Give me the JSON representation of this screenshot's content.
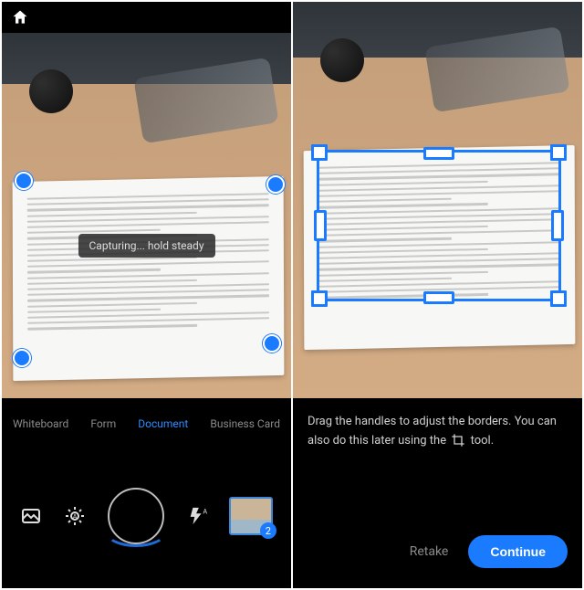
{
  "left": {
    "toast": "Capturing... hold steady",
    "modes": [
      "Whiteboard",
      "Form",
      "Document",
      "Business Card"
    ],
    "active_mode_index": 2,
    "thumbnail_count": "2",
    "icons": {
      "home": "home-icon",
      "gallery": "gallery-icon",
      "auto": "auto-capture-icon",
      "shutter": "shutter-button",
      "flash": "flash-auto-icon",
      "thumbnail": "recent-scan-thumbnail"
    }
  },
  "right": {
    "instruction_pre": "Drag the handles to adjust the borders. You can also do this later using the ",
    "instruction_post": " tool.",
    "retake_label": "Retake",
    "continue_label": "Continue"
  },
  "colors": {
    "accent": "#1a7bff"
  }
}
